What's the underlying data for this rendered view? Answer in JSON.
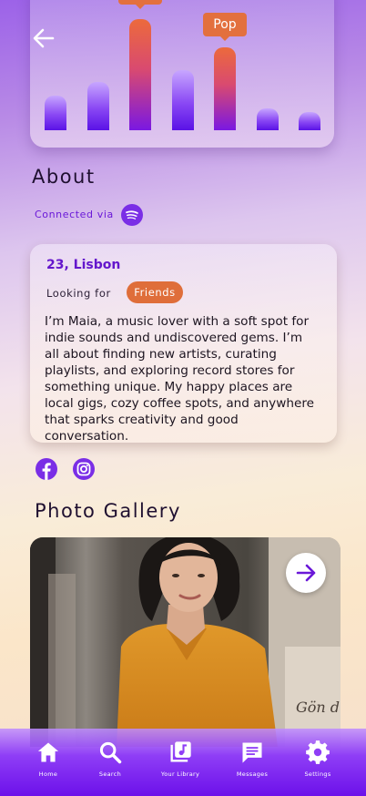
{
  "genre_chart": {
    "bars": [
      {
        "value": 0.27,
        "highlight": false
      },
      {
        "value": 0.38,
        "highlight": false
      },
      {
        "value": 0.87,
        "highlight": true
      },
      {
        "value": 0.47,
        "highlight": false
      },
      {
        "value": 0.65,
        "highlight": true,
        "label": "Pop"
      },
      {
        "value": 0.17,
        "highlight": false
      },
      {
        "value": 0.14,
        "highlight": false
      }
    ]
  },
  "about": {
    "title": "About",
    "connected_label": "Connected via",
    "age_location": "23, Lisbon",
    "looking_for_label": "Looking for",
    "looking_for_value": "Friends",
    "bio": "I’m Maia, a music lover with a soft spot for indie sounds and undiscovered gems. I’m all about finding new artists, curating playlists, and exploring record stores for something unique. My happy places are local gigs, cozy coffee spots, and anywhere that sparks creativity and good conversation."
  },
  "gallery": {
    "title": "Photo Gallery",
    "wall_text": "Gön d"
  },
  "tabs": [
    {
      "label": "Home",
      "icon": "home-icon"
    },
    {
      "label": "Search",
      "icon": "search-icon"
    },
    {
      "label": "Your Library",
      "icon": "library-icon"
    },
    {
      "label": "Messages",
      "icon": "messages-icon"
    },
    {
      "label": "Settings",
      "icon": "settings-icon"
    }
  ],
  "colors": {
    "accent_purple": "#6a18d8",
    "accent_orange": "#df6e3a",
    "tabbar": "#7a22ee"
  }
}
